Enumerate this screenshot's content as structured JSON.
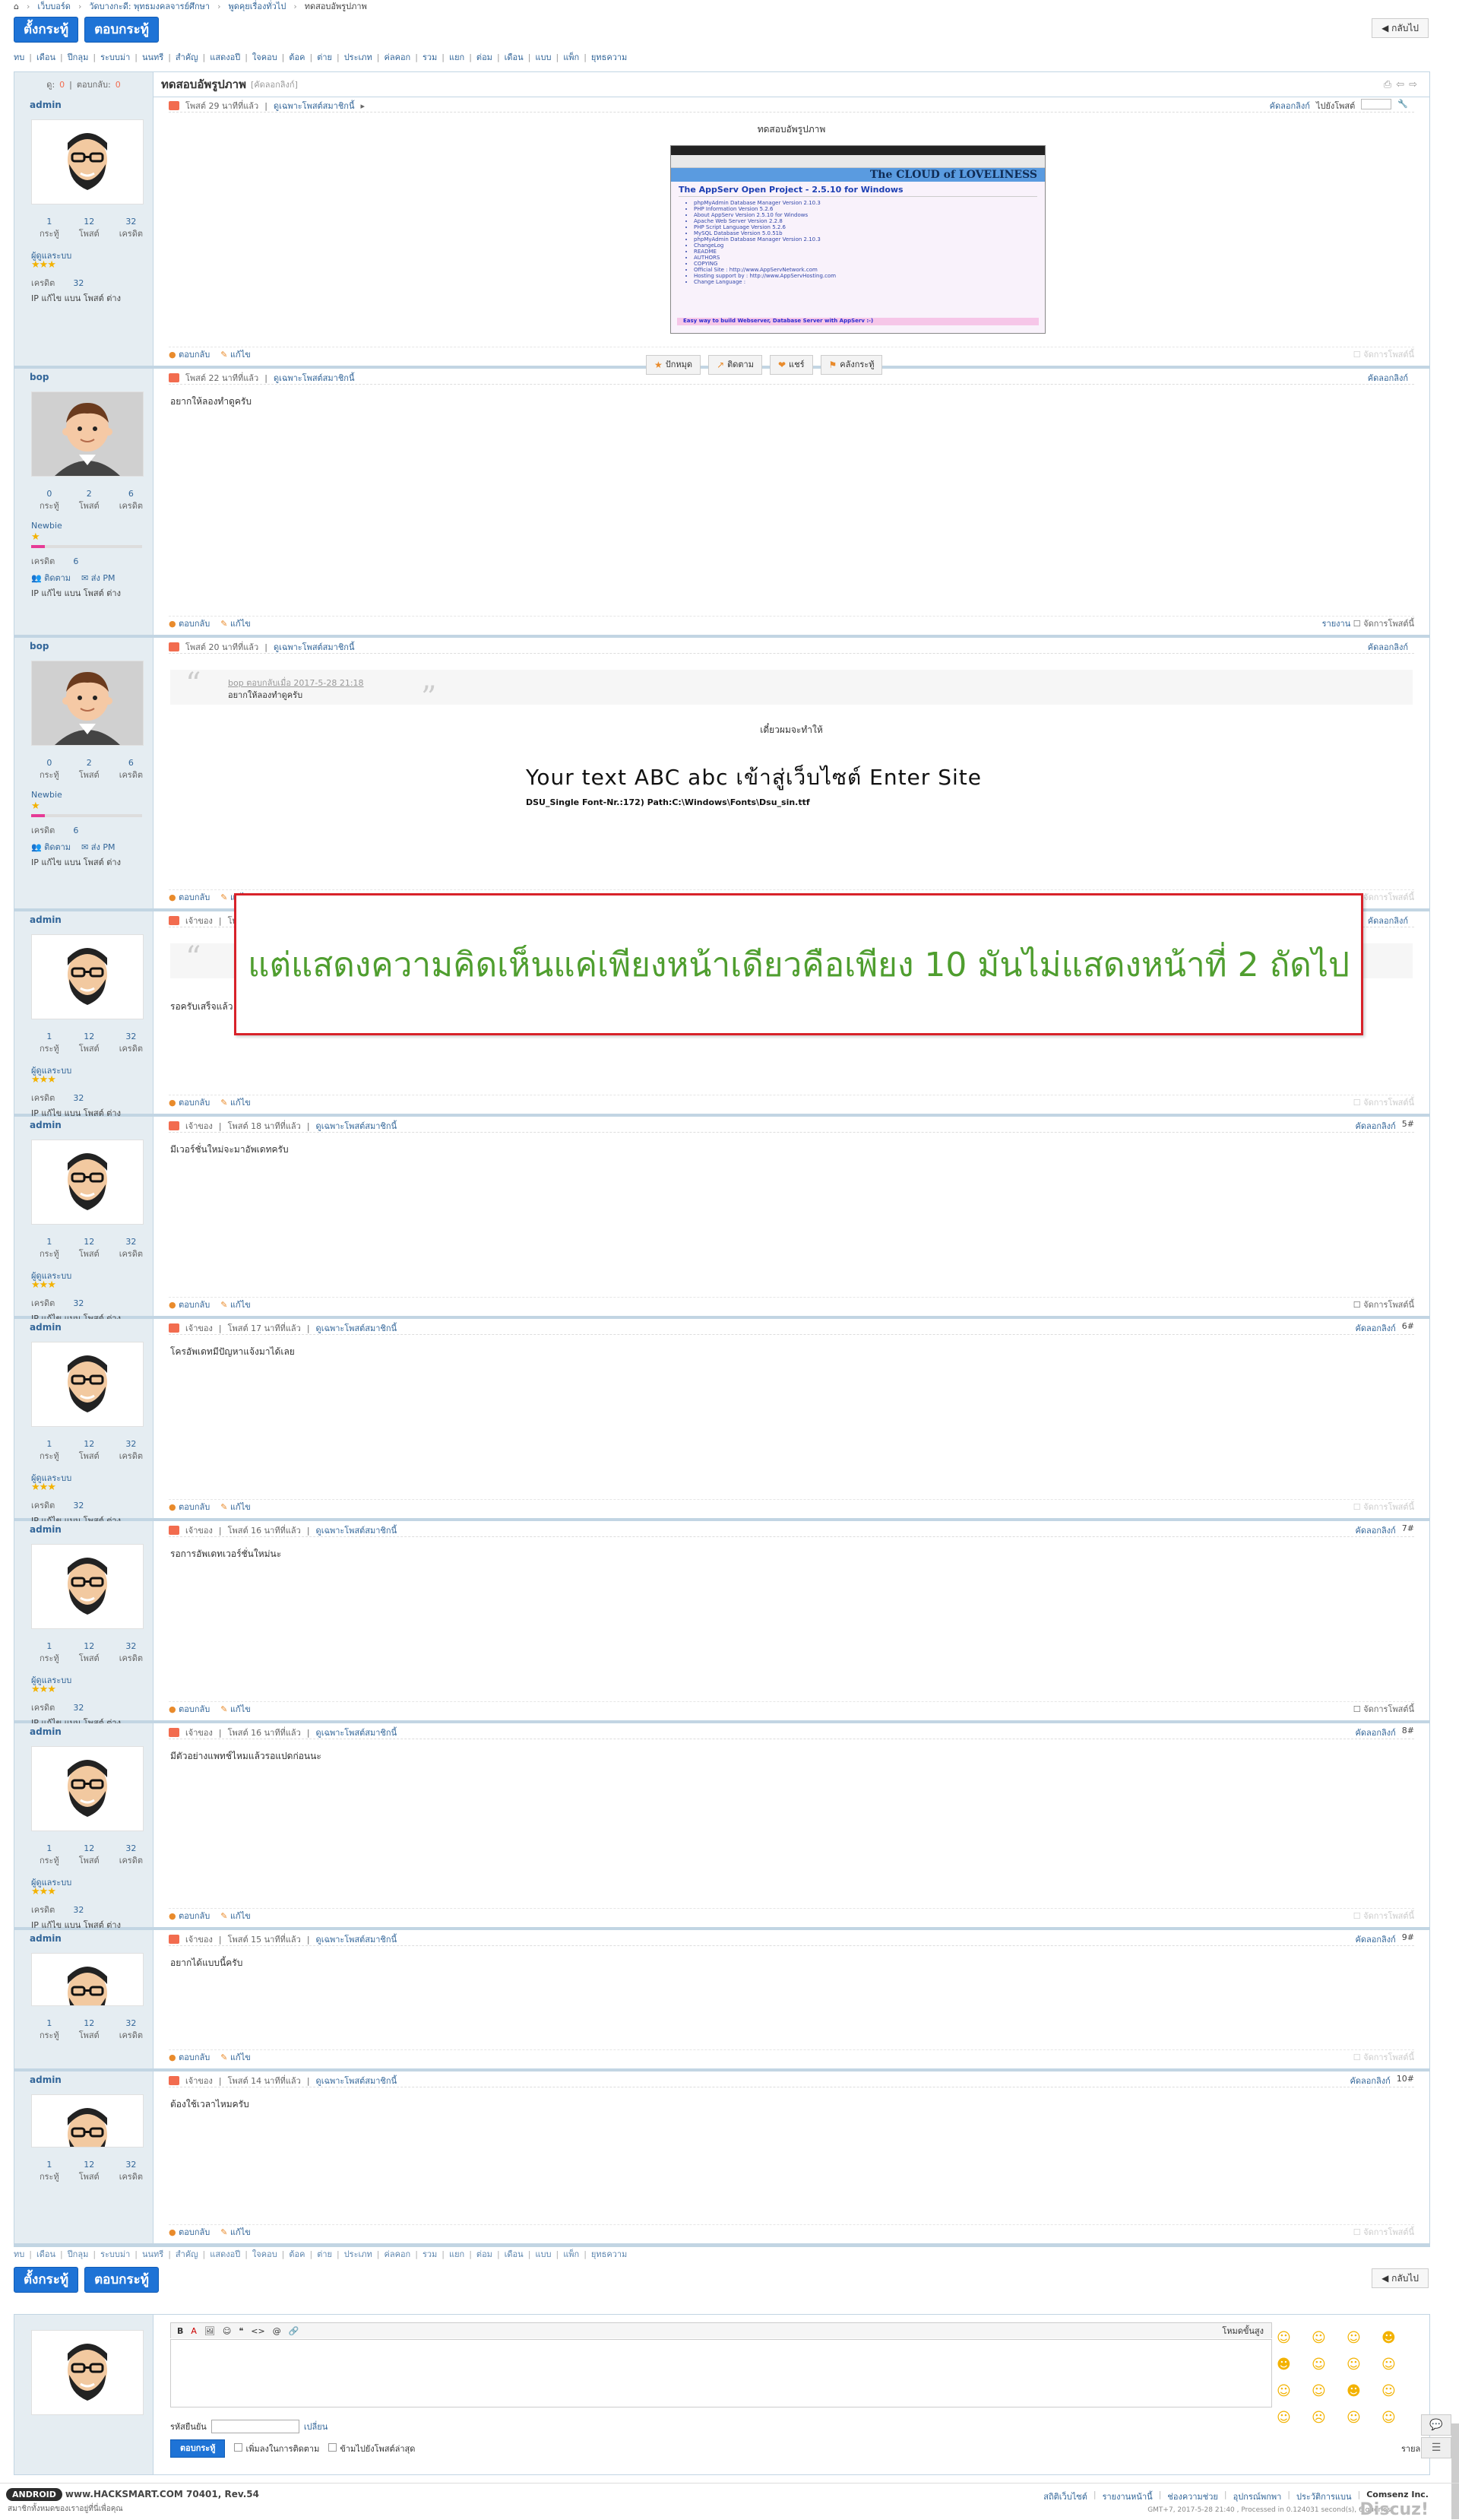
{
  "breadcrumb": [
    "เว็บบอร์ด",
    "วัดบางกะดี: พุทธมงคลจารย์ศึกษา",
    "พูดคุยเรื่องทั่วไป",
    "ทดสอบอัพรูปภาพ"
  ],
  "buttons": {
    "new_thread": "ตั้งกระทู้",
    "reply": "ตอบกระทู้",
    "back": "กลับไป"
  },
  "categories": [
    "ทบ",
    "เดือน",
    "ปีกลุม",
    "ระบบม่า",
    "นนทรี",
    "สำคัญ",
    "แสดงอปี",
    "ใจคอบ",
    "ต้อค",
    "ต่าย",
    "ประเภท",
    "ค่ลคอก",
    "รวม",
    "แยก",
    "ต่อม",
    "เดือน",
    "แบบ",
    "แพ็ก",
    "ยุทธความ"
  ],
  "thread": {
    "views_label": "ดู:",
    "views": "0",
    "replies_label": "ตอบกลับ:",
    "replies": "0",
    "title": "ทดสอบอัพรูปภาพ",
    "title_sub": "[คัดลอกลิงก์]",
    "tools": [
      "print-icon",
      "prev-icon",
      "next-icon"
    ]
  },
  "labels": {
    "posts": "กระทู้",
    "threads": "โพสต์",
    "credits": "เครดิต",
    "credit": "เครดิต",
    "ip_line": "IP แก้ไข แบน โพสต์ ต่าง",
    "reply": "ตอบกลับ",
    "edit": "แก้ไข",
    "manage": "จัดการโพสต์นี้",
    "report": "รายงาน",
    "copy_link": "คัดลอกลิงก์",
    "owner": "เจ้าของ",
    "only_author": "ดูเฉพาะโพสต์สมาชิกนี้",
    "add_friend": "ติดตาม",
    "send_pm": "ส่ง PM",
    "jump": "ไปยังโพสต์"
  },
  "users": {
    "admin": {
      "name": "admin",
      "posts": "1",
      "threads": "12",
      "credits": "32",
      "rank": "ผู้ดูแลระบบ",
      "stars": "★★★",
      "credit": "32"
    },
    "bop": {
      "name": "bop",
      "posts": "0",
      "threads": "2",
      "credits": "6",
      "rank": "Newbie",
      "stars": "★",
      "credit": "6",
      "bar": 0.12
    }
  },
  "posts": [
    {
      "time": "โพสต์ 29 นาทีที่แล้ว",
      "text": "ทดสอบอัพรูปภาพ",
      "floor": ""
    },
    {
      "time": "โพสต์ 22 นาทีที่แล้ว",
      "text": "อยากให้ลองทำดูครับ",
      "floor": ""
    },
    {
      "time": "โพสต์ 20 นาทีที่แล้ว",
      "text": "เดี๋ยวผมจะทำให้",
      "floor": ""
    },
    {
      "time": "โพสต์ 19 นาทีที่แล้ว",
      "text": "รอครับเสร็จแล้ว",
      "floor": ""
    },
    {
      "time": "โพสต์ 18 นาทีที่แล้ว",
      "text": "มีเวอร์ชั่นใหม่จะมาอัพเดทครับ",
      "floor": "5#"
    },
    {
      "time": "โพสต์ 17 นาทีที่แล้ว",
      "text": "โครอัพเดทมีปัญหาแจ้งมาได้เลย",
      "floor": "6#"
    },
    {
      "time": "โพสต์ 16 นาทีที่แล้ว",
      "text": "รอการอัพเดทเวอร์ชั่นใหม่นะ",
      "floor": "7#"
    },
    {
      "time": "โพสต์ 16 นาทีที่แล้ว",
      "text": "มีตัวอย่างแพทช์ไหมแล้วรอแปดก่อนนะ",
      "floor": "8#"
    },
    {
      "time": "โพสต์ 15 นาทีที่แล้ว",
      "text": "อยากได้แบบนี้ครับ",
      "floor": "9#"
    },
    {
      "time": "โพสต์ 14 นาทีที่แล้ว",
      "text": "ต้องใช้เวลาไหมครับ",
      "floor": "10#"
    }
  ],
  "quote": {
    "head": "bop ตอบกลับเมื่อ 2017-5-28 21:18",
    "text": "อยากให้ลองทำดูครับ"
  },
  "screenshot": {
    "banner": "The CLOUD of LOVELINESS",
    "title": "The AppServ Open Project - 2.5.10 for Windows",
    "items": [
      "phpMyAdmin Database Manager Version 2.10.3",
      "PHP Information Version 5.2.6",
      "About AppServ Version 2.5.10 for Windows",
      "Apache Web Server Version 2.2.8",
      "PHP Script Language Version 5.2.6",
      "MySQL Database Version 5.0.51b",
      "phpMyAdmin Database Manager Version 2.10.3",
      "ChangeLog",
      "README",
      "AUTHORS",
      "COPYING",
      "Official Site : http://www.AppServNetwork.com",
      "Hosting support by : http://www.AppServHosting.com",
      "Change Language :"
    ],
    "footer": "Easy way to build Webserver, Database Server with AppServ :-)"
  },
  "action_buttons": [
    {
      "icon": "star-icon",
      "label": "ปักหมุด"
    },
    {
      "icon": "follow-icon",
      "label": "ติดตาม"
    },
    {
      "icon": "heart-icon",
      "label": "แชร์"
    },
    {
      "icon": "bookmark-icon",
      "label": "คลังกระทู้"
    }
  ],
  "font_card": {
    "sample": "Your text ABC abc เข้าสู่เว็บไซต์ Enter Site",
    "path": "DSU_Single Font-Nr.:172) Path:C:\\Windows\\Fonts\\Dsu_sin.ttf"
  },
  "overlay_note": "แต่แสดงความคิดเห็นแค่เพียงหน้าเดียวคือเพียง 10  มันไม่แสดงหน้าที่ 2 ถัดไป",
  "editor": {
    "tools": [
      "B",
      "A",
      "IMG",
      "SMILE",
      "❝",
      "<>",
      "@",
      "LINK"
    ],
    "advanced": "โหมดขั้นสูง",
    "captcha_label": "รหัสยืนยัน",
    "change": "เปลี่ยน",
    "submit": "ตอบกระทู้",
    "opt_follow": "เพิ่มลงในการติดตาม",
    "opt_jump": "ข้ามไปยังโพสต์ล่าสุด",
    "detail": "รายละเอียดคะแนน"
  },
  "footer": {
    "brand": "ANDROID",
    "version_text": "www.HACKSMART.COM 70401, Rev.54",
    "slogan": "สมาชิกทั้งหมดของเราอยู่ที่นี่เพื่อคุณ",
    "links": [
      "สถิติเว็บไซต์",
      "รายงานหน้านี้",
      "ช่องความช่วย",
      "อุปกรณ์พกพา",
      "ประวัติการแบน"
    ],
    "company": "Comsenz Inc.",
    "gmt": "GMT+7, 2017-5-28 21:40 , Processed in 0.124031 second(s), 6 queries",
    "watermark": "Discuz!"
  },
  "colors": {
    "accent": "#1e73d6",
    "border": "#c2d5e3",
    "side": "#e5edf2",
    "overlay_border": "#d8222a",
    "overlay_text": "#4f9e2f"
  }
}
